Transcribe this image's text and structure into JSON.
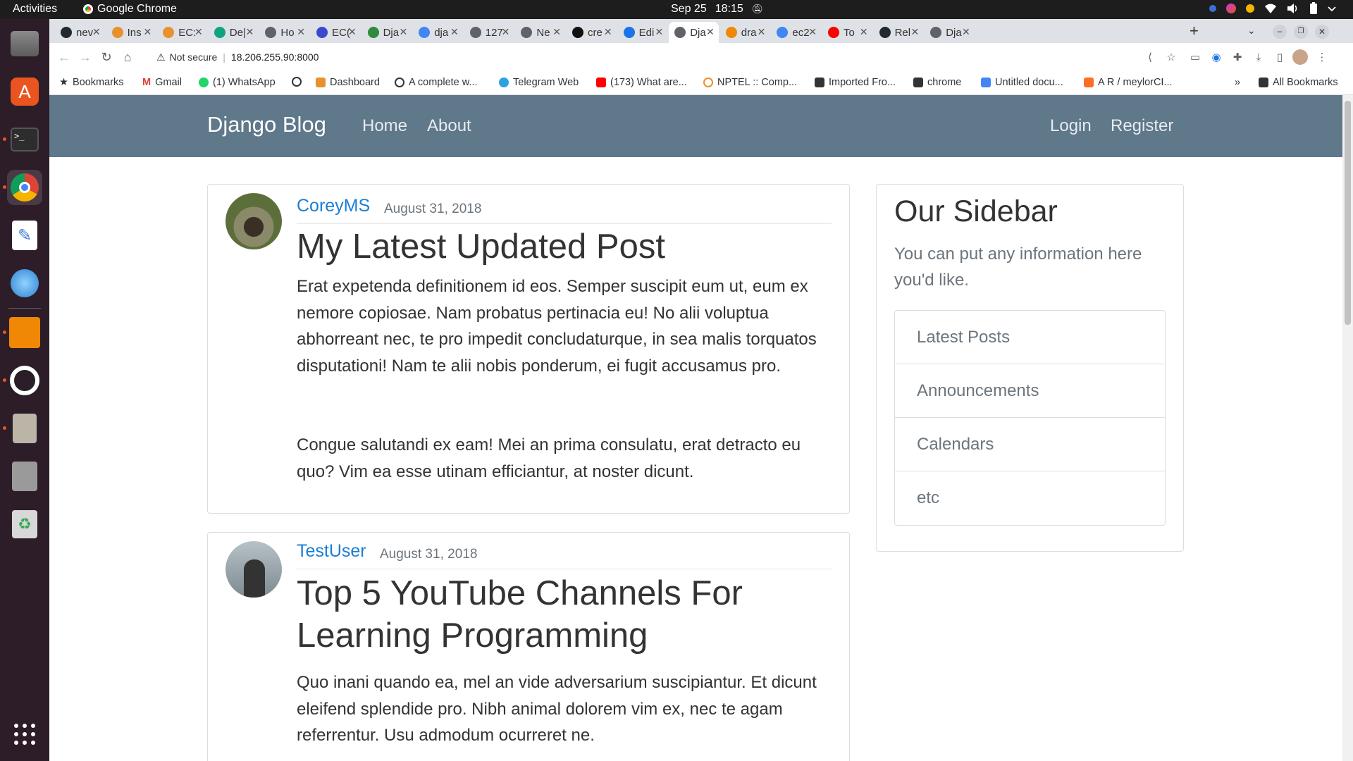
{
  "system": {
    "activities": "Activities",
    "app_name": "Google Chrome",
    "date": "Sep 25",
    "time": "18:15"
  },
  "dock": {
    "items": [
      "files-icon",
      "app-center-icon",
      "terminal-icon",
      "chrome-icon",
      "text-editor-icon",
      "settings-swirl-icon",
      "drawio-icon",
      "system-settings-icon",
      "archive-icon",
      "file-manager-icon",
      "trash-icon",
      "app-grid-icon"
    ]
  },
  "tabs": [
    {
      "label": "nev",
      "icon": "github-icon"
    },
    {
      "label": "Ins",
      "icon": "aws-icon"
    },
    {
      "label": "EC:",
      "icon": "aws-icon"
    },
    {
      "label": "De|",
      "icon": "chatgpt-icon"
    },
    {
      "label": "Ho",
      "icon": "globe-icon"
    },
    {
      "label": "EC(",
      "icon": "ec-icon"
    },
    {
      "label": "Dja",
      "icon": "w-icon"
    },
    {
      "label": "dja",
      "icon": "google-icon"
    },
    {
      "label": "127",
      "icon": "globe-icon"
    },
    {
      "label": "Ne",
      "icon": "globe-icon"
    },
    {
      "label": "cre",
      "icon": "openai-icon"
    },
    {
      "label": "Edi",
      "icon": "edit-icon"
    },
    {
      "label": "Dja",
      "icon": "globe-icon"
    },
    {
      "label": "dra",
      "icon": "drawio-icon"
    },
    {
      "label": "ec2",
      "icon": "google-icon"
    },
    {
      "label": "To",
      "icon": "youtube-icon"
    },
    {
      "label": "Rel",
      "icon": "github-icon"
    },
    {
      "label": "Dja",
      "icon": "globe-icon"
    }
  ],
  "omnibox": {
    "security": "Not secure",
    "url": "18.206.255.90:8000"
  },
  "bookmarks": [
    "Bookmarks",
    "Gmail",
    "(1) WhatsApp",
    "",
    "Dashboard",
    "A complete w...",
    "Telegram Web",
    "(173) What are...",
    "NPTEL :: Comp...",
    "Imported Fro...",
    "chrome",
    "Untitled docu...",
    "A R / meylorCI..."
  ],
  "bookmarks_more": "»",
  "all_bookmarks": "All Bookmarks",
  "site": {
    "brand": "Django Blog",
    "nav": {
      "home": "Home",
      "about": "About",
      "login": "Login",
      "register": "Register"
    }
  },
  "posts": [
    {
      "author": "CoreyMS",
      "date": "August 31, 2018",
      "title": "My Latest Updated Post",
      "body": [
        "Erat expetenda definitionem id eos. Semper suscipit eum ut, eum ex nemore copiosae. Nam probatus pertinacia eu! No alii voluptua abhorreant nec, te pro impedit concludaturque, in sea malis torquatos disputationi! Nam te alii nobis ponderum, ei fugit accusamus pro.",
        "Congue salutandi ex eam! Mei an prima consulatu, erat detracto eu quo? Vim ea esse utinam efficiantur, at noster dicunt."
      ]
    },
    {
      "author": "TestUser",
      "date": "August 31, 2018",
      "title": "Top 5 YouTube Channels For Learning Programming",
      "body": [
        "Quo inani quando ea, mel an vide adversarium suscipiantur. Et dicunt eleifend splendide pro. Nibh animal dolorem vim ex, nec te agam referrentur. Usu admodum ocurreret ne."
      ]
    }
  ],
  "sidebar": {
    "title": "Our Sidebar",
    "description": "You can put any information here you'd like.",
    "items": [
      "Latest Posts",
      "Announcements",
      "Calendars",
      "etc"
    ]
  },
  "colors": {
    "navbar": "#5f788a",
    "link": "#1a7fd4",
    "muted": "#6c757d"
  }
}
